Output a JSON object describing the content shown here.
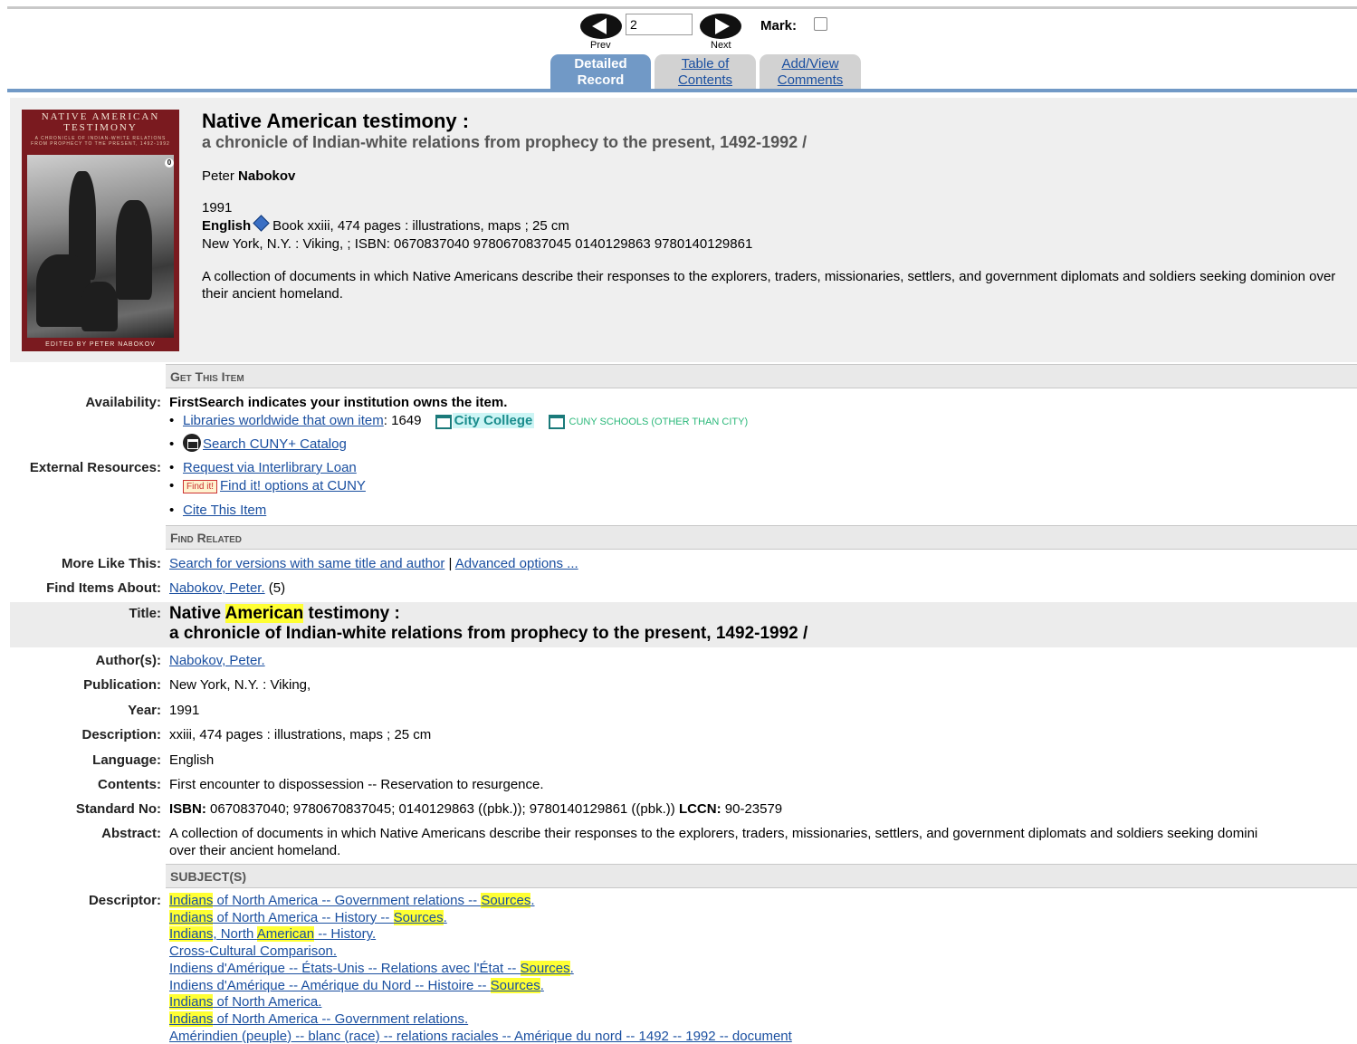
{
  "nav": {
    "page_value": "2",
    "prev_label": "Prev",
    "next_label": "Next",
    "mark_label": "Mark:",
    "tabs": [
      {
        "line1": "Detailed",
        "line2": "Record"
      },
      {
        "line1": "Table of",
        "line2": "Contents"
      },
      {
        "line1": "Add/View",
        "line2": "Comments"
      }
    ]
  },
  "cover": {
    "title": "NATIVE AMERICAN TESTIMONY",
    "subtitle": "A CHRONICLE OF INDIAN-WHITE RELATIONS FROM PROPHECY TO THE PRESENT, 1492-1992",
    "edited": "EDITED BY PETER NABOKOV"
  },
  "header": {
    "title": "Native American testimony :",
    "subtitle": "a chronicle of Indian-white relations from prophecy to the present, 1492-1992 /",
    "author_first": "Peter",
    "author_last": "Nabokov",
    "year": "1991",
    "language": "English",
    "format": "Book xxiii, 474 pages : illustrations, maps ; 25 cm",
    "publication": "New York, N.Y. : Viking, ; ISBN: 0670837040 9780670837045 0140129863 9780140129861",
    "abstract": "A collection of documents in which Native Americans describe their responses to the explorers, traders, missionaries, settlers, and government diplomats and soldiers seeking dominion over their ancient homeland."
  },
  "get_item": {
    "heading": "Get This Item",
    "availability_label": "Availability:",
    "availability_text": "FirstSearch indicates your institution owns the item.",
    "libraries_link": "Libraries worldwide that own item",
    "libraries_count": ": 1649",
    "city_college": "City College",
    "cuny_schools": "CUNY SCHOOLS (OTHER THAN CITY)",
    "search_catalog": "Search CUNY+ Catalog",
    "external_label": "External Resources:",
    "ill_link": "Request via Interlibrary Loan",
    "findit_badge": "Find it!",
    "findit_link": "Find it! options at CUNY",
    "cite_link": "Cite This Item"
  },
  "find_related": {
    "heading": "Find Related",
    "more_like_label": "More Like This:",
    "more_like_link": "Search for versions with same title and author",
    "separator": "|",
    "advanced_link": "Advanced options ...",
    "items_about_label": "Find Items About:",
    "items_about_link": "Nabokov, Peter.",
    "items_about_count": "(5)"
  },
  "details": {
    "title_label": "Title:",
    "title_pre": "Native ",
    "title_hl": "American",
    "title_post": " testimony :",
    "title_line2": "a chronicle of Indian-white relations from prophecy to the present, 1492-1992 /",
    "author_label": "Author(s):",
    "author_value": "Nabokov, Peter.",
    "publication_label": "Publication:",
    "publication_value": "New York, N.Y. : Viking,",
    "year_label": "Year:",
    "year_value": "1991",
    "description_label": "Description:",
    "description_value": "xxiii, 474 pages : illustrations, maps ; 25 cm",
    "language_label": "Language:",
    "language_value": "English",
    "contents_label": "Contents:",
    "contents_value": "First encounter to dispossession -- Reservation to resurgence.",
    "standard_label": "Standard No:",
    "isbn_label": "ISBN:",
    "isbn_value": " 0670837040; 9780670837045; 0140129863 ((pbk.)); 9780140129861 ((pbk.)) ",
    "lccn_label": "LCCN:",
    "lccn_value": " 90-23579",
    "abstract_label": "Abstract:",
    "abstract_line1": "A collection of documents in which Native Americans describe their responses to the explorers, traders, missionaries, settlers, and government diplomats and soldiers seeking domini",
    "abstract_line2": "over their ancient homeland."
  },
  "subjects": {
    "heading": "SUBJECT(S)",
    "descriptor_label": "Descriptor:",
    "items": [
      [
        {
          "t": "Indians",
          "h": true
        },
        {
          "t": " of North America -- Government relations -- ",
          "h": false
        },
        {
          "t": "Sources",
          "h": true
        },
        {
          "t": ".",
          "h": false
        }
      ],
      [
        {
          "t": "Indians",
          "h": true
        },
        {
          "t": " of North America -- History -- ",
          "h": false
        },
        {
          "t": "Sources",
          "h": true
        },
        {
          "t": ".",
          "h": false
        }
      ],
      [
        {
          "t": "Indians",
          "h": true
        },
        {
          "t": ", North ",
          "h": false
        },
        {
          "t": "American",
          "h": true
        },
        {
          "t": " -- History.",
          "h": false
        }
      ],
      [
        {
          "t": "Cross-Cultural Comparison.",
          "h": false
        }
      ],
      [
        {
          "t": "Indiens d'Amérique -- États-Unis -- Relations avec l'État -- ",
          "h": false
        },
        {
          "t": "Sources",
          "h": true
        },
        {
          "t": ".",
          "h": false
        }
      ],
      [
        {
          "t": "Indiens d'Amérique -- Amérique du Nord -- Histoire -- ",
          "h": false
        },
        {
          "t": "Sources",
          "h": true
        },
        {
          "t": ".",
          "h": false
        }
      ],
      [
        {
          "t": "Indians",
          "h": true
        },
        {
          "t": " of North America.",
          "h": false
        }
      ],
      [
        {
          "t": "Indians",
          "h": true
        },
        {
          "t": " of North America -- Government relations.",
          "h": false
        }
      ],
      [
        {
          "t": "Amérindien (peuple) -- blanc (race) -- relations raciales -- Amérique du nord -- 1492 -- 1992 -- document",
          "h": false
        }
      ]
    ]
  }
}
